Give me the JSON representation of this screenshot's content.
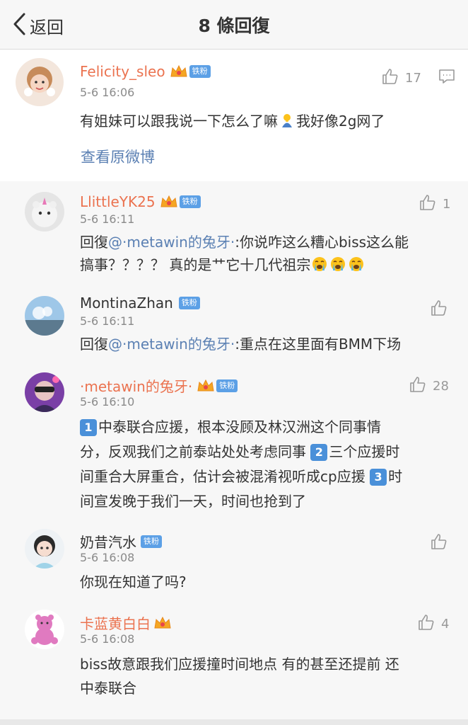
{
  "header": {
    "back_label": "返回",
    "title": "8 條回復"
  },
  "root": {
    "username": "Felicity_sleo",
    "badge": "铁粉",
    "time": "5-6 16:06",
    "text_a": "有姐妹可以跟我说一下怎么了嘛",
    "text_b": "我好像2g网了",
    "likes": "17",
    "view_weibo": "查看原微博"
  },
  "replies": [
    {
      "username": "LlittleYK25",
      "badge": "铁粉",
      "time": "5-6 16:11",
      "likes": "1",
      "reply_prefix": "回復",
      "mention": "@·metawin的兔牙·",
      "text_a": ":你说咋这么糟心biss这么能",
      "text_b": "搞事？？？？  真的是艹它十几代祖宗"
    },
    {
      "username": "MontinaZhan",
      "badge": "铁粉",
      "time": "5-6 16:11",
      "likes": "",
      "reply_prefix": "回復",
      "mention": "@·metawin的兔牙·",
      "text_a": ":重点在这里面有BMM下场"
    },
    {
      "username": "·metawin的兔牙·",
      "badge": "铁粉",
      "time": "5-6 16:10",
      "likes": "28",
      "n1": "1",
      "n2": "2",
      "n3": "3",
      "line1": "中泰联合应援，根本没顾及林汉洲这个同事情",
      "line2a": "分，反观我们之前泰站处处考虑同事",
      "line2b": "三个应援时",
      "line3a": "间重合大屏重合，估计会被混淆视听成cp应援",
      "line3b": "时",
      "line4": "间宣发晚于我们一天，时间也抢到了"
    },
    {
      "username": "奶昔汽水",
      "badge": "铁粉",
      "time": "5-6 16:08",
      "likes": "",
      "text_a": "你现在知道了吗?"
    },
    {
      "username": "卡蓝黄白白",
      "time": "5-6 16:08",
      "likes": "4",
      "text_a": "biss故意跟我们应援撞时间地点 有的甚至还提前 还",
      "text_b": "中泰联合"
    }
  ],
  "colors": {
    "username_orange": "#eb7350",
    "link_blue": "#5b80b3",
    "badge_blue": "#5ca0e6",
    "crown_gold": "#f5a623"
  },
  "icons": [
    "back-chevron-icon",
    "thumbs-up-icon",
    "comment-icon",
    "crown-icon",
    "crying-emoji-icon",
    "praying-emoji-icon"
  ]
}
